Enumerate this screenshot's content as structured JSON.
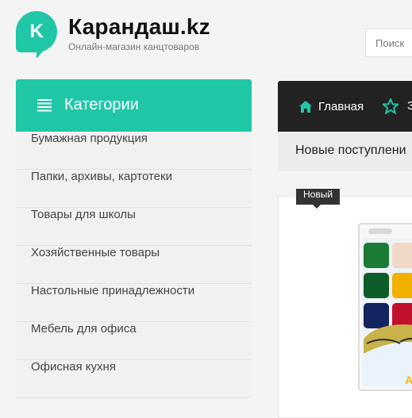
{
  "header": {
    "logo_letter": "K",
    "site_title": "Карандаш.kz",
    "site_subtitle": "Онлайн-магазин канцтоваров",
    "search_placeholder": "Поиск"
  },
  "sidebar": {
    "title": "Категории",
    "icon": "menu-icon",
    "items": [
      {
        "label": "Бумажная продукция"
      },
      {
        "label": "Папки, архивы, картотеки"
      },
      {
        "label": "Товары для школы"
      },
      {
        "label": "Хозяйственные товары"
      },
      {
        "label": "Настольные принадлежности"
      },
      {
        "label": "Мебель для офиса"
      },
      {
        "label": "Офисная кухня"
      }
    ]
  },
  "nav": {
    "home_label": "Главная",
    "home_icon": "home-icon",
    "star_icon": "star-icon",
    "next_label_partial": "З"
  },
  "content": {
    "section_title": "Новые поступлени",
    "badge": "Новый",
    "product": {
      "box_text": "Акв",
      "icon": "watercolor-paint-box"
    }
  },
  "colors": {
    "accent": "#1fc7a7",
    "nav_bg": "#222222",
    "sidebar_item_bg": "#f1f1f1",
    "page_bg": "#f4f4f4"
  }
}
